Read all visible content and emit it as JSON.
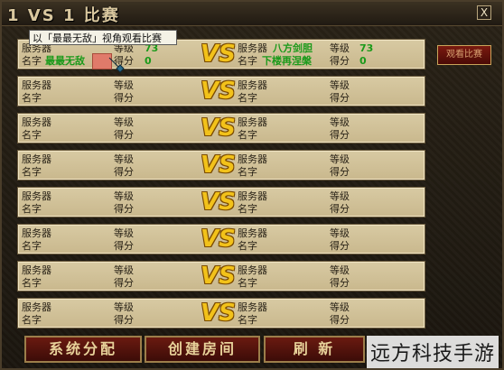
{
  "window": {
    "title": "1 VS 1 比赛",
    "close": "X"
  },
  "tooltip": "以「最最无敌」视角观看比赛",
  "side_button": "观看比赛",
  "labels": {
    "server": "服务器",
    "name": "名字",
    "level": "等级",
    "score": "得分",
    "vs": "VS"
  },
  "matches": [
    {
      "left": {
        "server": "",
        "name": "最最无敌",
        "level": "73",
        "score": "0"
      },
      "right": {
        "server": "八方剑胆",
        "name": "下楼再涅槃",
        "level": "73",
        "score": "0"
      }
    },
    {
      "left": {
        "server": "",
        "name": "",
        "level": "",
        "score": ""
      },
      "right": {
        "server": "",
        "name": "",
        "level": "",
        "score": ""
      }
    },
    {
      "left": {
        "server": "",
        "name": "",
        "level": "",
        "score": ""
      },
      "right": {
        "server": "",
        "name": "",
        "level": "",
        "score": ""
      }
    },
    {
      "left": {
        "server": "",
        "name": "",
        "level": "",
        "score": ""
      },
      "right": {
        "server": "",
        "name": "",
        "level": "",
        "score": ""
      }
    },
    {
      "left": {
        "server": "",
        "name": "",
        "level": "",
        "score": ""
      },
      "right": {
        "server": "",
        "name": "",
        "level": "",
        "score": ""
      }
    },
    {
      "left": {
        "server": "",
        "name": "",
        "level": "",
        "score": ""
      },
      "right": {
        "server": "",
        "name": "",
        "level": "",
        "score": ""
      }
    },
    {
      "left": {
        "server": "",
        "name": "",
        "level": "",
        "score": ""
      },
      "right": {
        "server": "",
        "name": "",
        "level": "",
        "score": ""
      }
    },
    {
      "left": {
        "server": "",
        "name": "",
        "level": "",
        "score": ""
      },
      "right": {
        "server": "",
        "name": "",
        "level": "",
        "score": ""
      }
    }
  ],
  "buttons": {
    "system": "系统分配",
    "create": "创建房间",
    "refresh": "刷 新"
  },
  "watermark": "远方科技手游"
}
